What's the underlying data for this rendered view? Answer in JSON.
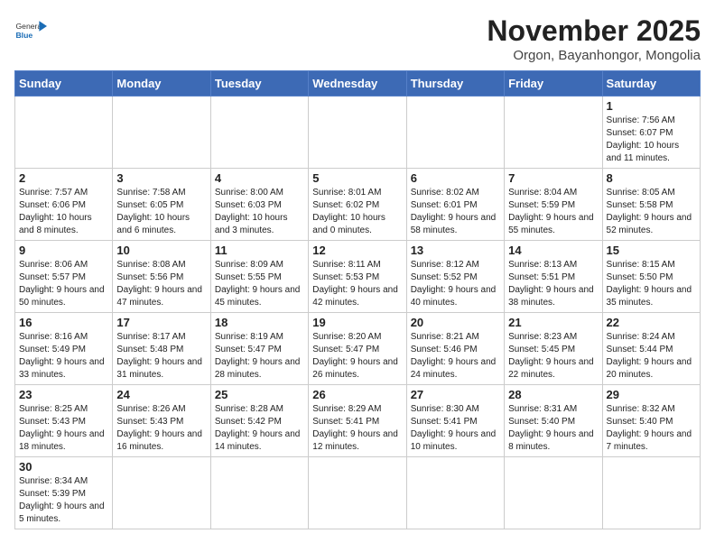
{
  "logo": {
    "text_general": "General",
    "text_blue": "Blue"
  },
  "title": "November 2025",
  "subtitle": "Orgon, Bayanhongor, Mongolia",
  "days_header": [
    "Sunday",
    "Monday",
    "Tuesday",
    "Wednesday",
    "Thursday",
    "Friday",
    "Saturday"
  ],
  "weeks": [
    [
      {
        "day": "",
        "info": ""
      },
      {
        "day": "",
        "info": ""
      },
      {
        "day": "",
        "info": ""
      },
      {
        "day": "",
        "info": ""
      },
      {
        "day": "",
        "info": ""
      },
      {
        "day": "",
        "info": ""
      },
      {
        "day": "1",
        "info": "Sunrise: 7:56 AM\nSunset: 6:07 PM\nDaylight: 10 hours and 11 minutes."
      }
    ],
    [
      {
        "day": "2",
        "info": "Sunrise: 7:57 AM\nSunset: 6:06 PM\nDaylight: 10 hours and 8 minutes."
      },
      {
        "day": "3",
        "info": "Sunrise: 7:58 AM\nSunset: 6:05 PM\nDaylight: 10 hours and 6 minutes."
      },
      {
        "day": "4",
        "info": "Sunrise: 8:00 AM\nSunset: 6:03 PM\nDaylight: 10 hours and 3 minutes."
      },
      {
        "day": "5",
        "info": "Sunrise: 8:01 AM\nSunset: 6:02 PM\nDaylight: 10 hours and 0 minutes."
      },
      {
        "day": "6",
        "info": "Sunrise: 8:02 AM\nSunset: 6:01 PM\nDaylight: 9 hours and 58 minutes."
      },
      {
        "day": "7",
        "info": "Sunrise: 8:04 AM\nSunset: 5:59 PM\nDaylight: 9 hours and 55 minutes."
      },
      {
        "day": "8",
        "info": "Sunrise: 8:05 AM\nSunset: 5:58 PM\nDaylight: 9 hours and 52 minutes."
      }
    ],
    [
      {
        "day": "9",
        "info": "Sunrise: 8:06 AM\nSunset: 5:57 PM\nDaylight: 9 hours and 50 minutes."
      },
      {
        "day": "10",
        "info": "Sunrise: 8:08 AM\nSunset: 5:56 PM\nDaylight: 9 hours and 47 minutes."
      },
      {
        "day": "11",
        "info": "Sunrise: 8:09 AM\nSunset: 5:55 PM\nDaylight: 9 hours and 45 minutes."
      },
      {
        "day": "12",
        "info": "Sunrise: 8:11 AM\nSunset: 5:53 PM\nDaylight: 9 hours and 42 minutes."
      },
      {
        "day": "13",
        "info": "Sunrise: 8:12 AM\nSunset: 5:52 PM\nDaylight: 9 hours and 40 minutes."
      },
      {
        "day": "14",
        "info": "Sunrise: 8:13 AM\nSunset: 5:51 PM\nDaylight: 9 hours and 38 minutes."
      },
      {
        "day": "15",
        "info": "Sunrise: 8:15 AM\nSunset: 5:50 PM\nDaylight: 9 hours and 35 minutes."
      }
    ],
    [
      {
        "day": "16",
        "info": "Sunrise: 8:16 AM\nSunset: 5:49 PM\nDaylight: 9 hours and 33 minutes."
      },
      {
        "day": "17",
        "info": "Sunrise: 8:17 AM\nSunset: 5:48 PM\nDaylight: 9 hours and 31 minutes."
      },
      {
        "day": "18",
        "info": "Sunrise: 8:19 AM\nSunset: 5:47 PM\nDaylight: 9 hours and 28 minutes."
      },
      {
        "day": "19",
        "info": "Sunrise: 8:20 AM\nSunset: 5:47 PM\nDaylight: 9 hours and 26 minutes."
      },
      {
        "day": "20",
        "info": "Sunrise: 8:21 AM\nSunset: 5:46 PM\nDaylight: 9 hours and 24 minutes."
      },
      {
        "day": "21",
        "info": "Sunrise: 8:23 AM\nSunset: 5:45 PM\nDaylight: 9 hours and 22 minutes."
      },
      {
        "day": "22",
        "info": "Sunrise: 8:24 AM\nSunset: 5:44 PM\nDaylight: 9 hours and 20 minutes."
      }
    ],
    [
      {
        "day": "23",
        "info": "Sunrise: 8:25 AM\nSunset: 5:43 PM\nDaylight: 9 hours and 18 minutes."
      },
      {
        "day": "24",
        "info": "Sunrise: 8:26 AM\nSunset: 5:43 PM\nDaylight: 9 hours and 16 minutes."
      },
      {
        "day": "25",
        "info": "Sunrise: 8:28 AM\nSunset: 5:42 PM\nDaylight: 9 hours and 14 minutes."
      },
      {
        "day": "26",
        "info": "Sunrise: 8:29 AM\nSunset: 5:41 PM\nDaylight: 9 hours and 12 minutes."
      },
      {
        "day": "27",
        "info": "Sunrise: 8:30 AM\nSunset: 5:41 PM\nDaylight: 9 hours and 10 minutes."
      },
      {
        "day": "28",
        "info": "Sunrise: 8:31 AM\nSunset: 5:40 PM\nDaylight: 9 hours and 8 minutes."
      },
      {
        "day": "29",
        "info": "Sunrise: 8:32 AM\nSunset: 5:40 PM\nDaylight: 9 hours and 7 minutes."
      }
    ],
    [
      {
        "day": "30",
        "info": "Sunrise: 8:34 AM\nSunset: 5:39 PM\nDaylight: 9 hours and 5 minutes."
      },
      {
        "day": "",
        "info": ""
      },
      {
        "day": "",
        "info": ""
      },
      {
        "day": "",
        "info": ""
      },
      {
        "day": "",
        "info": ""
      },
      {
        "day": "",
        "info": ""
      },
      {
        "day": "",
        "info": ""
      }
    ]
  ]
}
